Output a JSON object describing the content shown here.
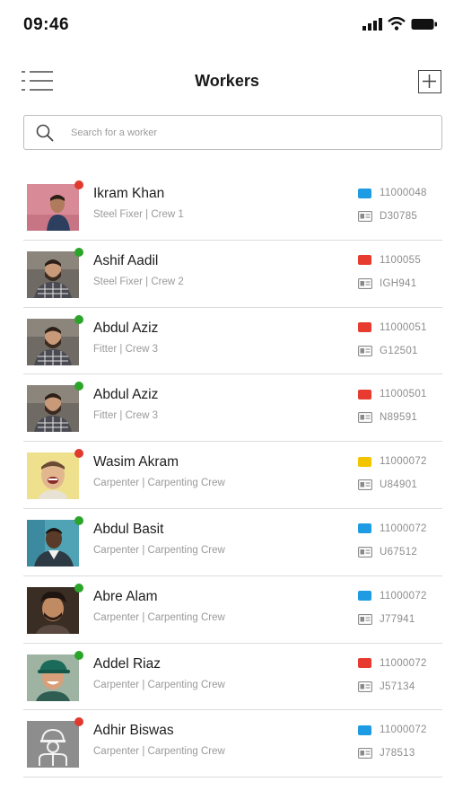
{
  "status_bar": {
    "time": "09:46"
  },
  "header": {
    "title": "Workers",
    "menu_icon": "list-menu-icon",
    "add_icon": "plus-square-icon"
  },
  "search": {
    "placeholder": "Search for a worker"
  },
  "colors": {
    "green": "#2aa52a",
    "red": "#e03a2f",
    "blue": "#1e9be3",
    "tag_red": "#e63b2e",
    "yellow": "#f2c500"
  },
  "workers": [
    {
      "name": "Ikram Khan",
      "role": "Steel Fixer | Crew 1",
      "tag": "11000048",
      "tag_color": "#1e9be3",
      "id": "D30785",
      "status_color": "#e03a2f",
      "avatar": "man-pink-background"
    },
    {
      "name": "Ashif Aadil",
      "role": "Steel Fixer | Crew 2",
      "tag": "1100055",
      "tag_color": "#e63b2e",
      "id": "IGH941",
      "status_color": "#2aa52a",
      "avatar": "bearded-man-plaid"
    },
    {
      "name": "Abdul Aziz",
      "role": "Fitter | Crew 3",
      "tag": "11000051",
      "tag_color": "#e63b2e",
      "id": "G12501",
      "status_color": "#2aa52a",
      "avatar": "bearded-man-plaid"
    },
    {
      "name": "Abdul Aziz",
      "role": "Fitter | Crew 3",
      "tag": "11000501",
      "tag_color": "#e63b2e",
      "id": "N89591",
      "status_color": "#2aa52a",
      "avatar": "bearded-man-plaid"
    },
    {
      "name": "Wasim Akram",
      "role": "Carpenter | Carpenting Crew",
      "tag": "11000072",
      "tag_color": "#f2c500",
      "id": "U84901",
      "status_color": "#e03a2f",
      "avatar": "laughing-man-yellow"
    },
    {
      "name": "Abdul Basit",
      "role": "Carpenter | Carpenting Crew",
      "tag": "11000072",
      "tag_color": "#1e9be3",
      "id": "U67512",
      "status_color": "#2aa52a",
      "avatar": "man-teal-background"
    },
    {
      "name": "Abre Alam",
      "role": "Carpenter | Carpenting Crew",
      "tag": "11000072",
      "tag_color": "#1e9be3",
      "id": "J77941",
      "status_color": "#2aa52a",
      "avatar": "man-curly-hair"
    },
    {
      "name": "Addel Riaz",
      "role": "Carpenter | Carpenting Crew",
      "tag": "11000072",
      "tag_color": "#e63b2e",
      "id": "J57134",
      "status_color": "#2aa52a",
      "avatar": "man-cap-smiling"
    },
    {
      "name": "Adhir Biswas",
      "role": "Carpenter | Carpenting Crew",
      "tag": "11000072",
      "tag_color": "#1e9be3",
      "id": "J78513",
      "status_color": "#e03a2f",
      "avatar": "worker-helmet-placeholder"
    }
  ]
}
